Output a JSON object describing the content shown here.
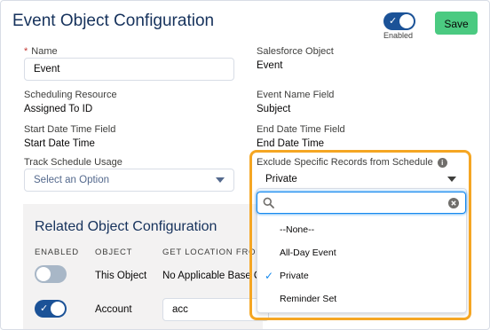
{
  "header": {
    "title": "Event Object Configuration",
    "toggle_label": "Enabled",
    "save_label": "Save"
  },
  "form": {
    "name_label": "Name",
    "name_value": "Event",
    "salesforce_object_label": "Salesforce Object",
    "salesforce_object_value": "Event",
    "scheduling_resource_label": "Scheduling Resource",
    "scheduling_resource_value": "Assigned To ID",
    "event_name_field_label": "Event Name Field",
    "event_name_field_value": "Subject",
    "start_label": "Start Date Time Field",
    "start_value": "Start Date Time",
    "end_label": "End Date Time Field",
    "end_value": "End Date Time",
    "track_label": "Track Schedule Usage",
    "track_placeholder": "Select an Option",
    "exclude_label": "Exclude Specific Records from Schedule",
    "exclude_value": "Private"
  },
  "related": {
    "title": "Related Object Configuration",
    "columns": [
      "ENABLED",
      "OBJECT",
      "GET LOCATION FRO"
    ],
    "rows": [
      {
        "enabled": false,
        "object": "This Object",
        "location": "No Applicable Base O"
      },
      {
        "enabled": true,
        "object": "Account",
        "location": "acc"
      }
    ]
  },
  "dropdown": {
    "search_value": "",
    "options": [
      {
        "label": "--None--",
        "selected": false
      },
      {
        "label": "All-Day Event",
        "selected": false
      },
      {
        "label": "Private",
        "selected": true
      },
      {
        "label": "Reminder Set",
        "selected": false
      }
    ]
  }
}
